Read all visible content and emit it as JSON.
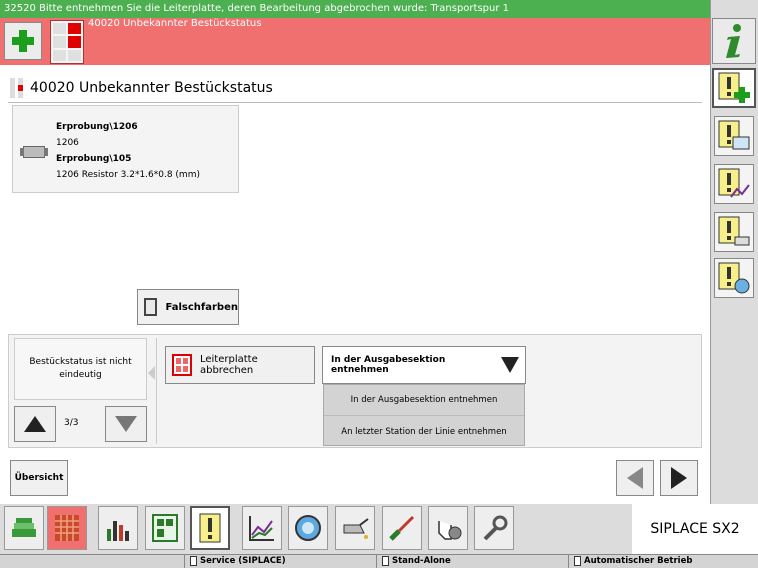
{
  "top_message": "32520 Bitte entnehmen Sie die Leiterplatte, deren Bearbeitung abgebrochen wurde: Transportspur 1",
  "alert": {
    "text": "40020 Unbekannter Bestückstatus"
  },
  "header": {
    "title": "40020 Unbekannter Bestückstatus"
  },
  "component": {
    "line1": "Erprobung\\1206",
    "line2": "1206",
    "line3": "Erprobung\\105",
    "line4": "1206 Resistor  3.2*1.6*0.8 (mm)"
  },
  "false_colors_label": "Falschfarben",
  "status_message": "Bestückstatus ist nicht eindeutig",
  "pager": {
    "text": "3/3"
  },
  "abort_button_label": "Leiterplatte abbrechen",
  "select": {
    "value": "In der Ausgabesektion entnehmen",
    "options": [
      "In der Ausgabesektion entnehmen",
      "An letzter Station der Linie entnehmen"
    ]
  },
  "overview_label": "Übersicht",
  "brand": "SIPLACE SX2",
  "statusbar": {
    "user": "Service (SIPLACE)",
    "mode": "Stand-Alone",
    "operation": "Automatischer Betrieb"
  },
  "colors": {
    "accent_green": "#4caf50",
    "alert_red": "#f06f6f"
  }
}
